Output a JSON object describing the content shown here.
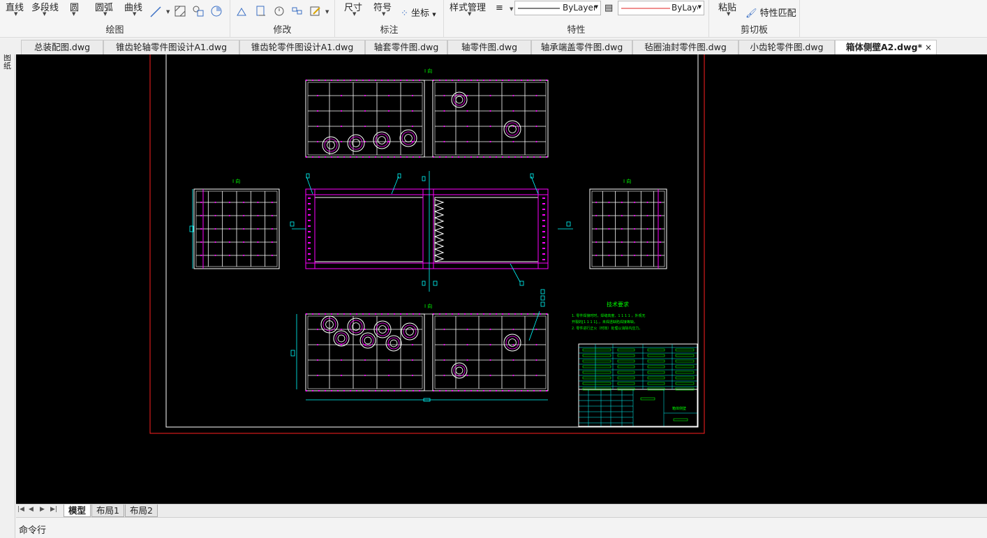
{
  "ribbon": {
    "draw": {
      "label": "绘图",
      "line": "直线",
      "polyline": "多段线",
      "circle": "圆",
      "arc": "圆弧",
      "curve": "曲线"
    },
    "modify": {
      "label": "修改"
    },
    "annotate": {
      "label": "标注",
      "dimension": "尺寸",
      "symbol": "符号",
      "coordinate": "坐标"
    },
    "properties": {
      "label": "特性",
      "style_manager": "样式管理",
      "linetype_value": "ByLayer",
      "color_value": "ByLayer"
    },
    "clipboard": {
      "label": "剪切板",
      "paste": "粘贴",
      "match_properties": "特性匹配"
    }
  },
  "left_strip": {
    "label": "图纸"
  },
  "tabs": [
    {
      "label": "总装配图.dwg",
      "active": false
    },
    {
      "label": "锥齿轮轴零件图设计A1.dwg",
      "active": false
    },
    {
      "label": "锥齿轮零件图设计A1.dwg",
      "active": false
    },
    {
      "label": "轴套零件图.dwg",
      "active": false
    },
    {
      "label": "轴零件图.dwg",
      "active": false
    },
    {
      "label": "轴承端盖零件图.dwg",
      "active": false
    },
    {
      "label": "毡圈油封零件图.dwg",
      "active": false
    },
    {
      "label": "小齿轮零件图.dwg",
      "active": false
    },
    {
      "label": "箱体侧壁A2.dwg*",
      "active": true
    }
  ],
  "tab_close": "×",
  "drawing": {
    "view_label": "I 向",
    "tech_title": "技术要求",
    "tech_lines": [
      "1. 零件焊接时时，焊缝高度、1 1 1 1 ，外观无",
      "    开裂的[1 1 1 1]、，未焊透缺陷焊接等缺。",
      "2. 零件进行正火（时效）处理以消除内应力。"
    ],
    "title_block_name": "箱体侧壁"
  },
  "layout_tabs": [
    {
      "label": "模型",
      "active": true
    },
    {
      "label": "布局1",
      "active": false
    },
    {
      "label": "布局2",
      "active": false
    }
  ],
  "nav_arrows": [
    "|◀",
    "◀",
    "▶",
    "▶|"
  ],
  "command_line": {
    "label": "命令行"
  },
  "colors": {
    "canvas": "#000000",
    "frame_red": "#ff2020",
    "cad_white": "#ffffff",
    "cad_magenta": "#ff00ff",
    "cad_green": "#00ff00",
    "cad_cyan": "#00ffff"
  }
}
